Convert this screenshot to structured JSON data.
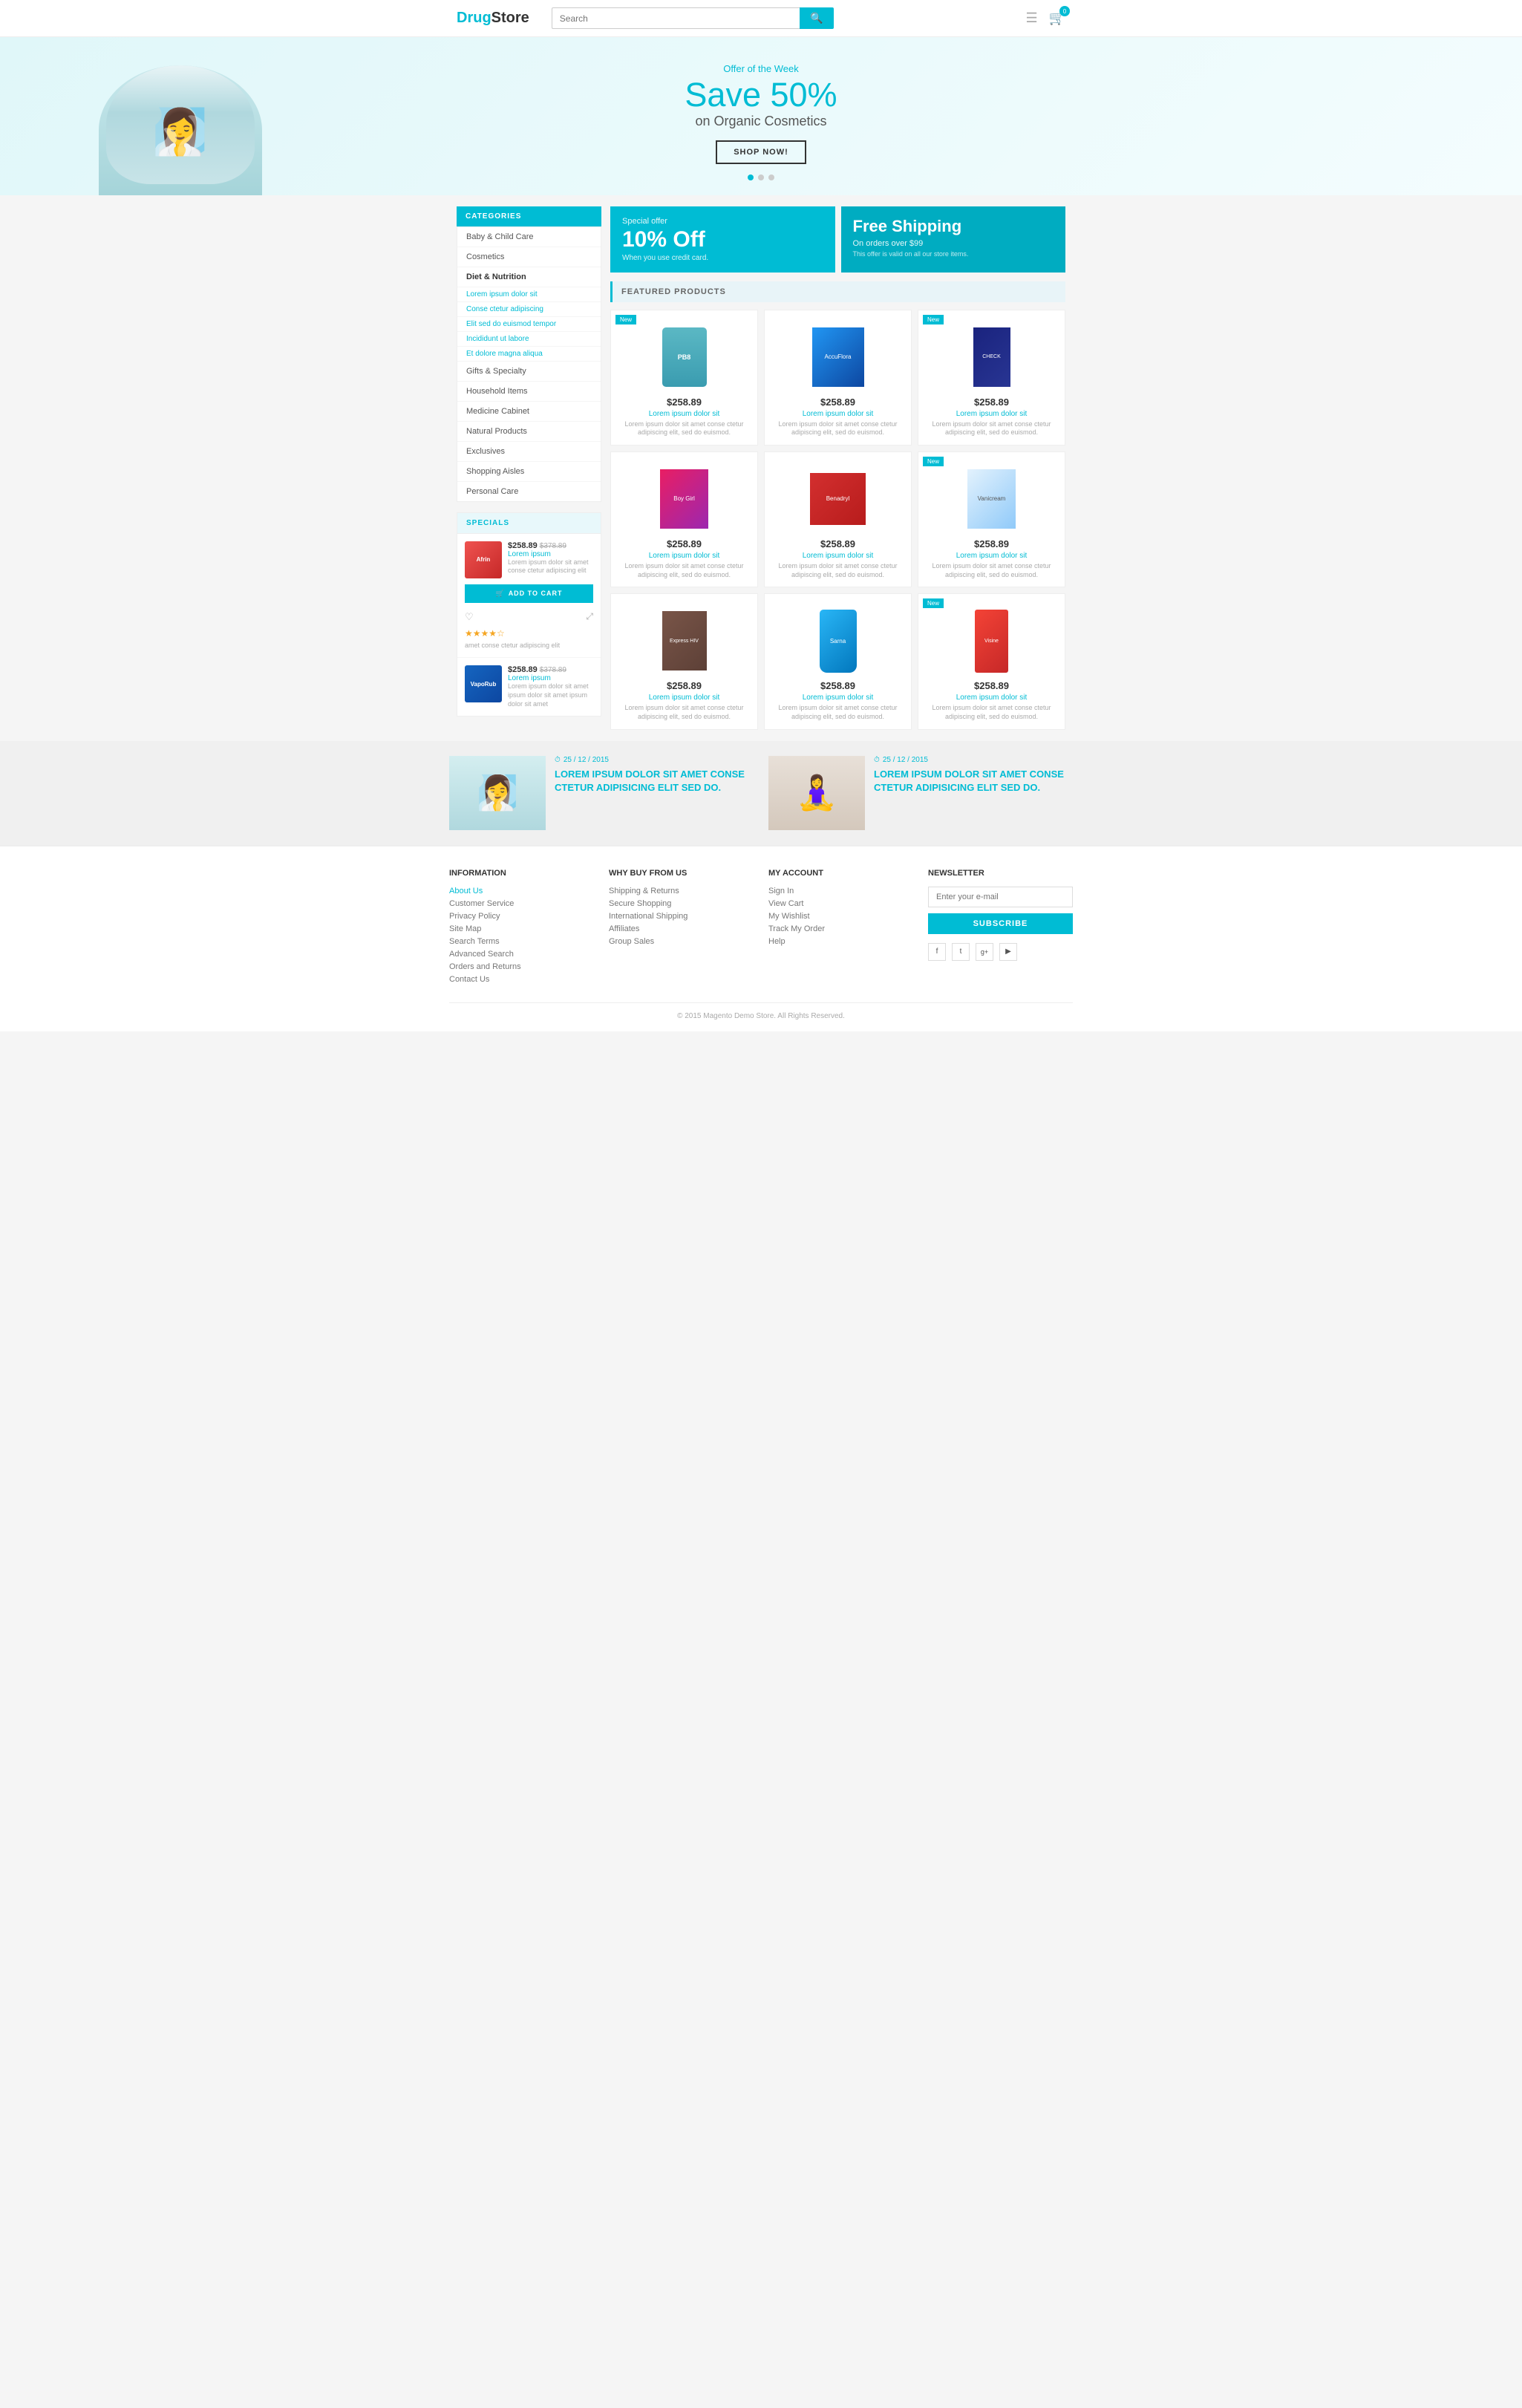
{
  "header": {
    "logo_drug": "Drug",
    "logo_store": "Store",
    "search_placeholder": "Search",
    "cart_count": "0"
  },
  "hero": {
    "offer_label": "Offer of the Week",
    "title_line1": "Save 50%",
    "title_line2": "on Organic Cosmetics",
    "cta_button": "SHOP NOW!",
    "dots": [
      true,
      false,
      false
    ]
  },
  "categories": {
    "section_title": "CATEGORIES",
    "items": [
      {
        "label": "Baby & Child Care"
      },
      {
        "label": "Cosmetics"
      },
      {
        "label": "Diet & Nutrition"
      },
      {
        "label": "Lorem ipsum dolor sit"
      },
      {
        "label": "Conse ctetur adipiscing"
      },
      {
        "label": "Elit sed do euismod tempor"
      },
      {
        "label": "Incididunt ut labore"
      },
      {
        "label": "Et dolore magna aliqua"
      },
      {
        "label": "Gifts & Specialty"
      },
      {
        "label": "Household Items"
      },
      {
        "label": "Medicine Cabinet"
      },
      {
        "label": "Natural Products"
      },
      {
        "label": "Exclusives"
      },
      {
        "label": "Shopping Aisles"
      },
      {
        "label": "Personal Care"
      }
    ]
  },
  "specials": {
    "section_title": "SPECIALS",
    "items": [
      {
        "thumb_label": "Afrin",
        "price_current": "$258.89",
        "price_old": "$378.89",
        "name": "Lorem ipsum",
        "desc": "Lorem ipsum dolor sit amet conse ctetur adipiscing elit",
        "stars": "★★★★☆",
        "extra_desc": "amet conse ctetur adipiscing elit"
      },
      {
        "thumb_label": "VapoRub",
        "price_current": "$258.89",
        "price_old": "$378.89",
        "name": "Lorem ipsum",
        "desc": "Lorem ipsum dolor sit amet ipsum dolor sit amet ipsum dolor sit amet"
      }
    ],
    "add_to_cart": "ADD TO CART"
  },
  "promo_banners": [
    {
      "label": "Special offer",
      "value": "10% Off",
      "desc": "When you use credit card."
    },
    {
      "label": "Free Shipping",
      "value_line1": "Free Shipping",
      "desc": "On orders over $99",
      "sub": "This offer is valid on all our store items."
    }
  ],
  "featured": {
    "title": "FEATURED PRODUCTS",
    "products": [
      {
        "badge": "New",
        "img_type": "pb8",
        "img_label": "PB8",
        "price": "$258.89",
        "name": "Lorem ipsum dolor sit",
        "desc": "Lorem ipsum dolor sit amet conse ctetur adipiscing elit, sed do euismod."
      },
      {
        "badge": "",
        "img_type": "blue_box",
        "img_label": "AccuFlora",
        "price": "$258.89",
        "name": "Lorem ipsum dolor sit",
        "desc": "Lorem ipsum dolor sit amet conse ctetur adipiscing elit, sed do euismod."
      },
      {
        "badge": "New",
        "img_type": "dark_box",
        "img_label": "CHECK",
        "price": "$258.89",
        "name": "Lorem ipsum dolor sit",
        "desc": "Lorem ipsum dolor sit amet conse ctetur adipiscing elit, sed do euismod."
      },
      {
        "badge": "",
        "img_type": "boygirl",
        "img_label": "Boy Girl",
        "price": "$258.89",
        "name": "Lorem ipsum dolor sit",
        "desc": "Lorem ipsum dolor sit amet conse ctetur adipiscing elit, sed do euismod."
      },
      {
        "badge": "",
        "img_type": "benadryl",
        "img_label": "Benadryl",
        "price": "$258.89",
        "name": "Lorem ipsum dolor sit",
        "desc": "Lorem ipsum dolor sit amet conse ctetur adipiscing elit, sed do euismod."
      },
      {
        "badge": "New",
        "img_type": "vanicream",
        "img_label": "Vanicream",
        "price": "$258.89",
        "name": "Lorem ipsum dolor sit",
        "desc": "Lorem ipsum dolor sit amet conse ctetur adipiscing elit, sed do euismod."
      },
      {
        "badge": "",
        "img_type": "express",
        "img_label": "Express HIV",
        "price": "$258.89",
        "name": "Lorem ipsum dolor sit",
        "desc": "Lorem ipsum dolor sit amet conse ctetur adipiscing elit, sed do euismod."
      },
      {
        "badge": "",
        "img_type": "blue_bottle",
        "img_label": "Sarna",
        "price": "$258.89",
        "name": "Lorem ipsum dolor sit",
        "desc": "Lorem ipsum dolor sit amet conse ctetur adipiscing elit, sed do euismod."
      },
      {
        "badge": "New",
        "img_type": "visine",
        "img_label": "Visine",
        "price": "$258.89",
        "name": "Lorem ipsum dolor sit",
        "desc": "Lorem ipsum dolor sit amet conse ctetur adipiscing elit, sed do euismod."
      }
    ]
  },
  "blog": {
    "items": [
      {
        "date": "25 / 12 / 2015",
        "title": "LOREM IPSUM DOLOR SIT AMET CONSE CTETUR ADIPISICING ELIT SED DO."
      },
      {
        "date": "25 / 12 / 2015",
        "title": "LOREM IPSUM DOLOR SIT AMET CONSE CTETUR ADIPISICING ELIT SED DO."
      }
    ]
  },
  "footer": {
    "information": {
      "title": "INFORMATION",
      "links": [
        {
          "label": "About Us",
          "highlight": true
        },
        {
          "label": "Customer Service",
          "highlight": false
        },
        {
          "label": "Privacy Policy",
          "highlight": false
        },
        {
          "label": "Site Map",
          "highlight": false
        },
        {
          "label": "Search Terms",
          "highlight": false
        },
        {
          "label": "Advanced Search",
          "highlight": false
        },
        {
          "label": "Orders and Returns",
          "highlight": false
        },
        {
          "label": "Contact Us",
          "highlight": false
        }
      ]
    },
    "why_buy": {
      "title": "WHY BUY FROM US",
      "links": [
        "Shipping & Returns",
        "Secure Shopping",
        "International Shipping",
        "Affiliates",
        "Group Sales"
      ]
    },
    "my_account": {
      "title": "MY ACCOUNT",
      "links": [
        "Sign In",
        "View Cart",
        "My Wishlist",
        "Track My Order",
        "Help"
      ]
    },
    "newsletter": {
      "title": "NEWSLETTER",
      "placeholder": "Enter your e-mail",
      "button": "SUBSCRIBE"
    },
    "social": [
      "f",
      "t",
      "g+",
      "▶"
    ],
    "copyright": "© 2015 Magento Demo Store. All Rights Reserved."
  }
}
